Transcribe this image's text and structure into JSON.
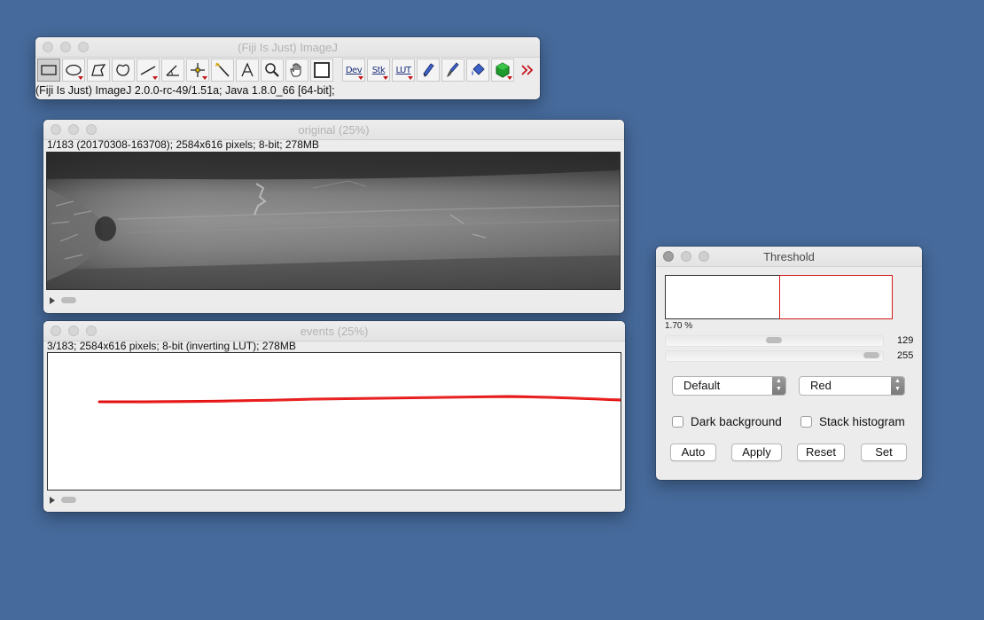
{
  "imagej": {
    "title": "(Fiji Is Just) ImageJ",
    "status": "(Fiji Is Just) ImageJ 2.0.0-rc-49/1.51a; Java 1.8.0_66 [64-bit];",
    "tools": [
      {
        "name": "rectangle-tool",
        "icon": "rectangle-icon"
      },
      {
        "name": "oval-tool",
        "icon": "oval-icon"
      },
      {
        "name": "polygon-tool",
        "icon": "polygon-icon"
      },
      {
        "name": "freehand-tool",
        "icon": "freehand-icon"
      },
      {
        "name": "line-tool",
        "icon": "line-icon"
      },
      {
        "name": "angle-tool",
        "icon": "angle-icon"
      },
      {
        "name": "point-tool",
        "icon": "crosshair-icon"
      },
      {
        "name": "wand-tool",
        "icon": "wand-icon"
      },
      {
        "name": "text-tool",
        "icon": "text-icon"
      },
      {
        "name": "zoom-tool",
        "icon": "magnifier-icon"
      },
      {
        "name": "hand-tool",
        "icon": "hand-icon"
      },
      {
        "name": "color-picker-tool",
        "icon": "color-box-icon"
      },
      {
        "name": "dev-tool",
        "label": "Dev"
      },
      {
        "name": "stk-tool",
        "label": "Stk"
      },
      {
        "name": "lut-tool",
        "label": "LUT"
      },
      {
        "name": "pencil-tool",
        "icon": "pencil-icon"
      },
      {
        "name": "brush-tool",
        "icon": "brush-icon"
      },
      {
        "name": "flood-fill-tool",
        "icon": "bucket-icon"
      },
      {
        "name": "3d-viewer-tool",
        "icon": "gem-icon"
      },
      {
        "name": "more-tools",
        "icon": "double-chevron-icon"
      }
    ]
  },
  "original": {
    "title": "original (25%)",
    "info": "1/183 (20170308-163708); 2584x616 pixels; 8-bit; 278MB"
  },
  "events": {
    "title": "events (25%)",
    "info": "3/183; 2584x616 pixels; 8-bit (inverting LUT); 278MB"
  },
  "threshold": {
    "title": "Threshold",
    "percent": "1.70 %",
    "min_value": "129",
    "max_value": "255",
    "min_fraction": 0.506,
    "max_fraction": 1.0,
    "method": "Default",
    "mode": "Red",
    "dark_background_label": "Dark background",
    "stack_histogram_label": "Stack histogram",
    "dark_background_checked": false,
    "stack_histogram_checked": false,
    "buttons": {
      "auto": "Auto",
      "apply": "Apply",
      "reset": "Reset",
      "set": "Set"
    }
  },
  "colors": {
    "desktop": "#466a9b",
    "threshold_red": "#d41a1a"
  }
}
